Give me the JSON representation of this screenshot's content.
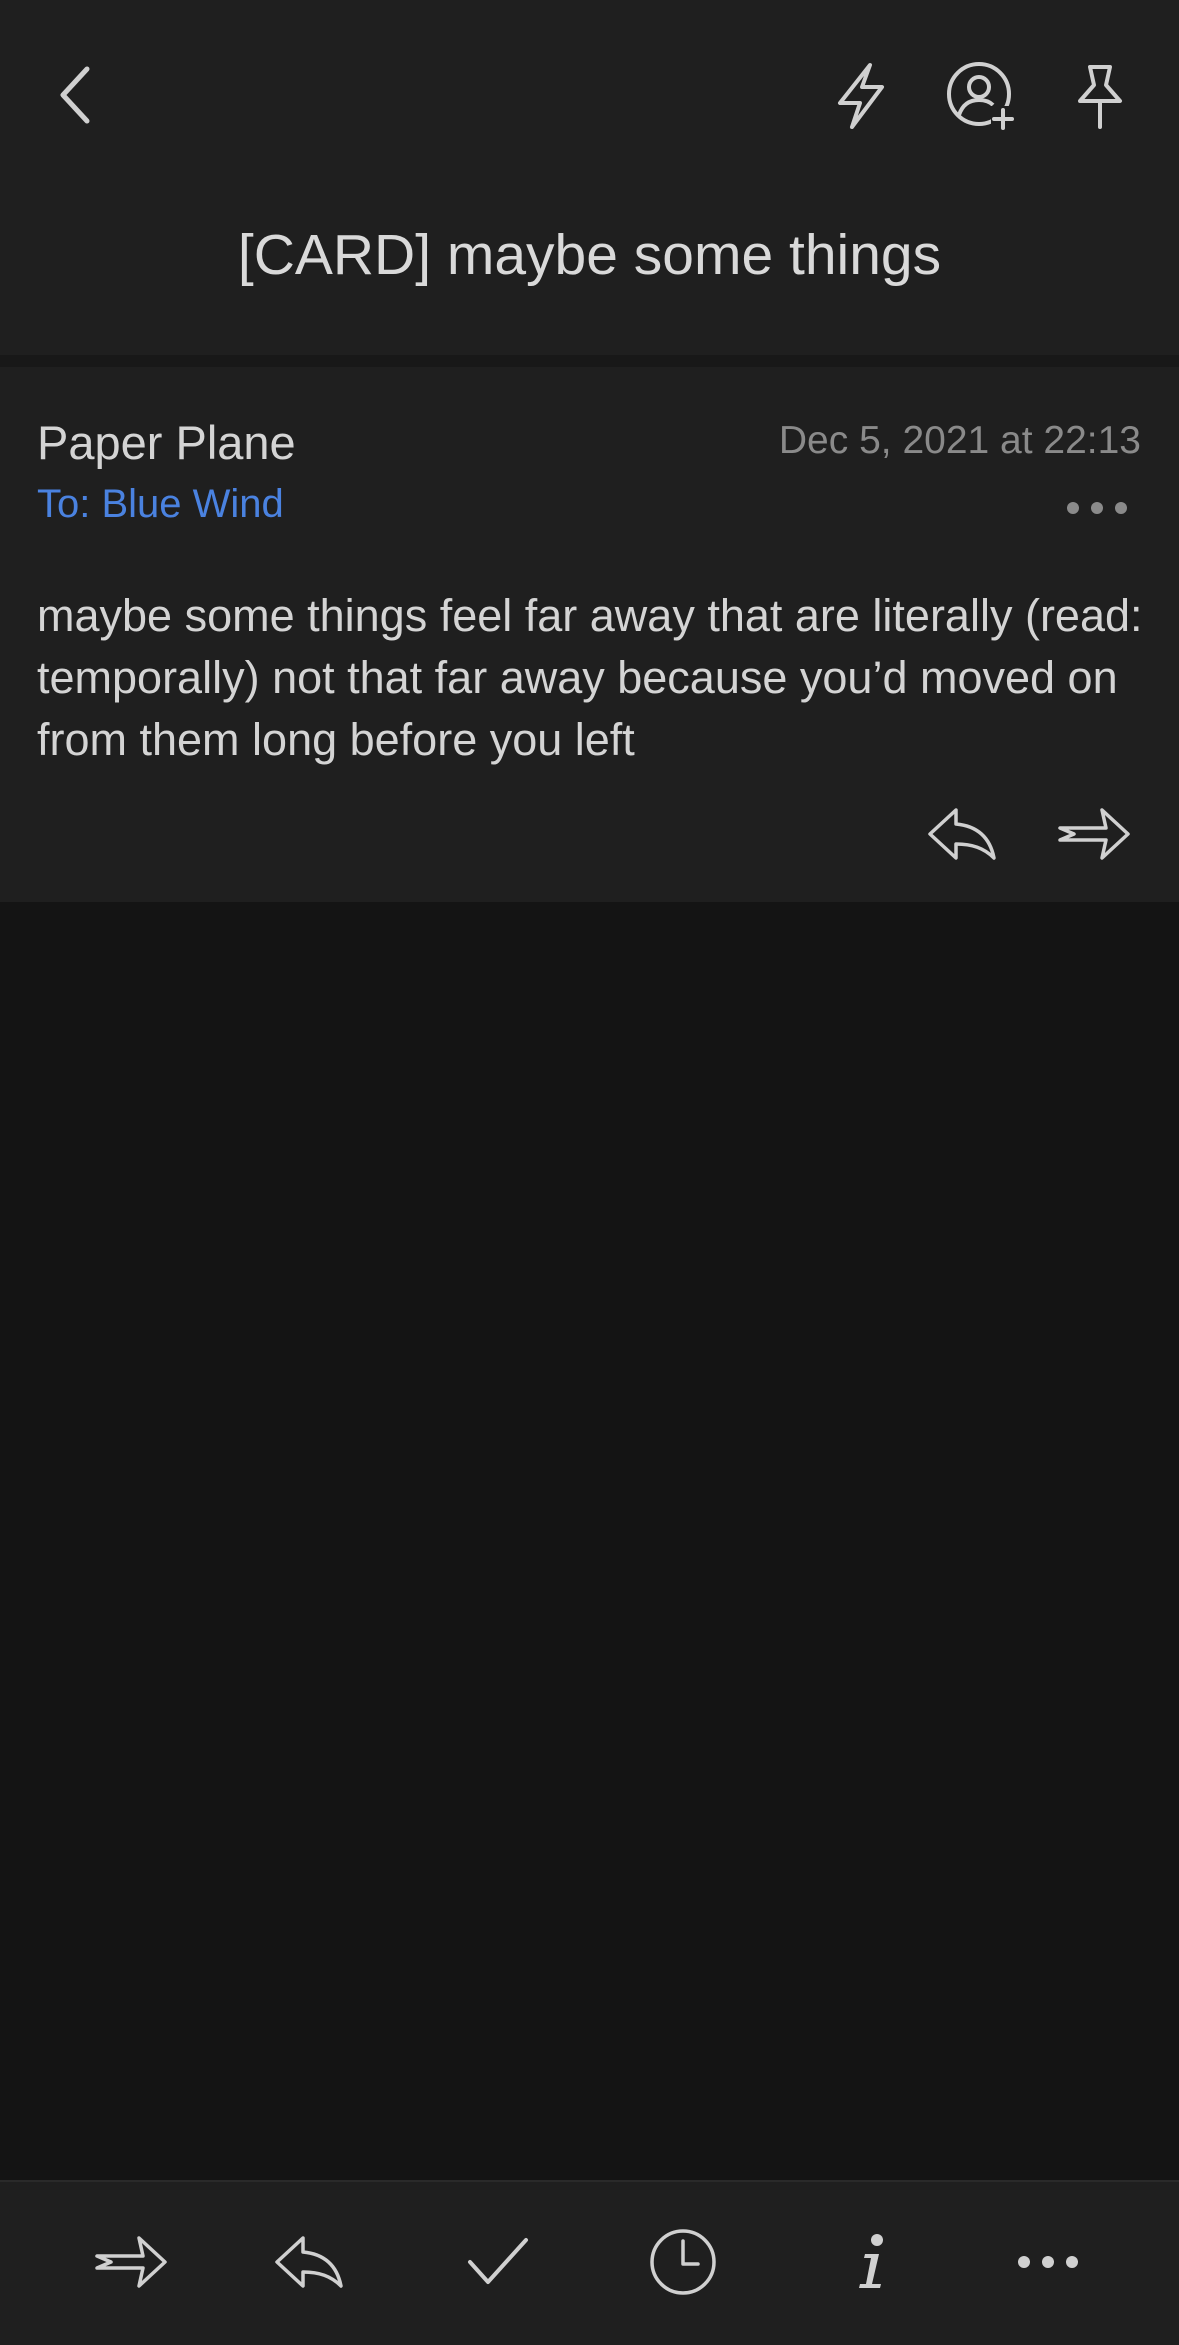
{
  "header": {
    "subject": "[CARD] maybe some things",
    "icons": [
      "back-chevron-icon",
      "lightning-bolt-icon",
      "add-contact-icon",
      "pin-icon"
    ]
  },
  "message": {
    "sender": "Paper Plane",
    "date": "Dec 5, 2021 at 22:13",
    "recipient": "To: Blue Wind",
    "body": "maybe some things feel far away that are literally (read: temporally) not that far away because you’d moved on from them long before you left",
    "actions": [
      "reply-icon",
      "forward-icon"
    ]
  },
  "toolbar": {
    "icons": [
      "forward-icon",
      "reply-icon",
      "checkmark-icon",
      "clock-icon",
      "info-icon",
      "more-icon"
    ]
  },
  "colors": {
    "background": "#141414",
    "surface": "#1f1f1f",
    "accent": "#4a82e0",
    "text": "#d4d4d4",
    "muted": "#8a8a8a"
  }
}
